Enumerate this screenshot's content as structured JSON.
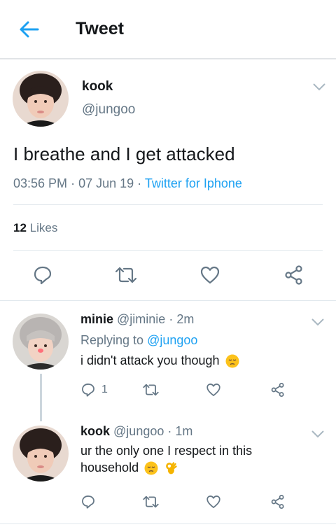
{
  "header": {
    "title": "Tweet"
  },
  "main_tweet": {
    "name": "kook",
    "handle": "@jungoo",
    "text": "I breathe and I get attacked",
    "time": "03:56 PM",
    "sep1": "·",
    "date": "07 Jun 19",
    "sep2": "·",
    "source": "Twitter for Iphone",
    "likes_count": "12",
    "likes_label": "Likes"
  },
  "replies": [
    {
      "name": "minie",
      "handle": "@jiminie",
      "time": "· 2m",
      "replying_prefix": "Replying to",
      "replying_to": "@jungoo",
      "text": "i didn't attack you though",
      "emojis": [
        "pensive-face"
      ],
      "reply_count": "1"
    },
    {
      "name": "kook",
      "handle": "@jungoo",
      "time": "· 1m",
      "text_line1": "ur the only one I respect in this",
      "text_line2": "household",
      "emojis": [
        "pensive-face",
        "ok-hand"
      ]
    }
  ],
  "colors": {
    "accent": "#1da1f2",
    "muted": "#657786",
    "text": "#14171a",
    "divider": "#e1e8ed"
  }
}
